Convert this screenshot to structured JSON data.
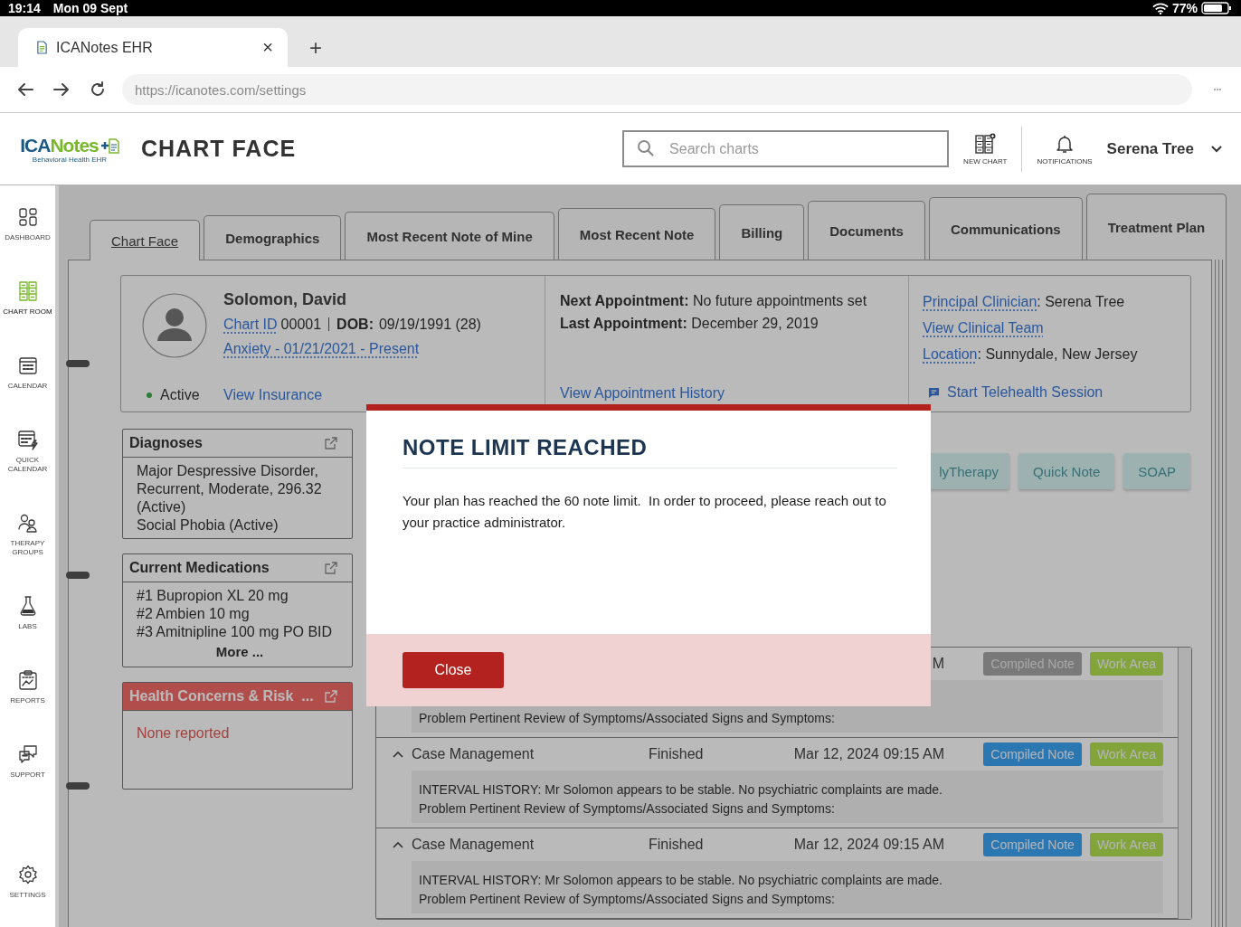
{
  "status_bar": {
    "time": "19:14",
    "date": "Mon 09 Sept",
    "battery": "77%"
  },
  "browser": {
    "tab": {
      "title": "ICANotes EHR",
      "close": "×"
    },
    "new_tab": "+",
    "url": "https://icanotes.com/settings"
  },
  "app_header": {
    "logo": {
      "first": "ICA",
      "second": "Notes",
      "tagline": "Behavioral Health EHR"
    },
    "title": "CHART FACE",
    "search": {
      "placeholder": "Search charts"
    },
    "actions": [
      {
        "label": "NEW CHART",
        "kind": "chart"
      },
      {
        "label": "NOTIFICATIONS",
        "kind": "bell"
      }
    ],
    "user": "Serena Tree"
  },
  "sidebar": {
    "items": [
      {
        "label": "DASHBOARD",
        "kind": "dashboard",
        "selected": false
      },
      {
        "label": "CHART ROOM",
        "kind": "chart",
        "selected": true
      },
      {
        "label": "CALENDAR",
        "kind": "calendar",
        "selected": false
      },
      {
        "label": "QUICK CALENDAR",
        "kind": "quickcal",
        "selected": false
      },
      {
        "label": "THERAPY GROUPS",
        "kind": "groups",
        "selected": false
      },
      {
        "label": "LABS",
        "kind": "labs",
        "selected": false
      },
      {
        "label": "REPORTS",
        "kind": "reports",
        "selected": false
      },
      {
        "label": "SUPPORT",
        "kind": "support",
        "selected": false
      },
      {
        "label": "SETTINGS",
        "kind": "settings",
        "selected": false
      }
    ]
  },
  "tabs": [
    {
      "label": "Chart Face",
      "selected": true
    },
    {
      "label": "Demographics",
      "selected": false
    },
    {
      "label": "Most Recent Note of Mine",
      "selected": false
    },
    {
      "label": "Most Recent Note",
      "selected": false
    },
    {
      "label": "Billing",
      "selected": false
    },
    {
      "label": "Documents",
      "selected": false
    },
    {
      "label": "Communications",
      "selected": false
    },
    {
      "label": "Treatment Plan",
      "selected": false
    }
  ],
  "patient": {
    "name": "Solomon, David",
    "chart_id_link": "Chart ID",
    "chart_id": "00001",
    "dob_label": "DOB:",
    "dob": "09/19/1991 (28)",
    "diagnosis_link": "Anxiety - 01/21/2021 - Present",
    "status": {
      "label": "Active",
      "color": "#2d7c36"
    },
    "insurance_link": "View Insurance",
    "next_appointment": "**Next Appointment:** No future appointments set",
    "last_appointment": "**Last Appointment:** December 29, 2019",
    "history_link": "View Appointment History",
    "clinician": {
      "link": "Principal Clinician",
      "text": ": Serena Tree"
    },
    "team_link": "View Clinical Team",
    "location": {
      "link": "Location",
      "text": ": Sunnydale, New Jersey"
    },
    "telehealth_link": "Start Telehealth Session"
  },
  "panels": [
    {
      "title": "Diagnoses",
      "kind": "normal",
      "lines": [
        "Major Despressive Disorder, Recurrent, Moderate, 296.32 (Active)",
        "Social Phobia (Active)"
      ]
    },
    {
      "title": "Current Medications",
      "kind": "normal",
      "lines": [
        "#1 Bupropion XL 20 mg",
        "#2 Ambien 10 mg",
        "#3 Amitnipline 100 mg PO BID"
      ],
      "more": "More ..."
    },
    {
      "title": "Health Concerns & Risk  ...",
      "kind": "alert",
      "lines": [
        "None reported"
      ]
    }
  ],
  "note_types": [
    "lyTherapy",
    "Quick Note",
    "SOAP"
  ],
  "notes": [
    {
      "date": "M",
      "expanded": true,
      "actions": [
        {
          "label": "Compiled Note",
          "kind": "compiled",
          "disabled": true
        },
        {
          "label": "Work Area",
          "kind": "work",
          "disabled": false
        }
      ],
      "lines": [
        "Problem Pertinent Review of Symptoms/Associated Signs and Symptoms:"
      ]
    },
    {
      "type": "Case Management",
      "status": "Finished",
      "date": "Mar 12, 2024 09:15 AM",
      "expanded": true,
      "actions": [
        {
          "label": "Compiled Note",
          "kind": "compiled",
          "disabled": false
        },
        {
          "label": "Work Area",
          "kind": "work",
          "disabled": false
        }
      ],
      "lines": [
        "INTERVAL HISTORY: Mr Solomon appears to be stable. No psychiatric complaints are made.",
        "Problem Pertinent Review of Symptoms/Associated Signs and Symptoms:"
      ]
    },
    {
      "type": "Case Management",
      "status": "Finished",
      "date": "Mar 12, 2024 09:15 AM",
      "expanded": true,
      "actions": [
        {
          "label": "Compiled Note",
          "kind": "compiled",
          "disabled": false
        },
        {
          "label": "Work Area",
          "kind": "work",
          "disabled": false
        }
      ],
      "lines": [
        "INTERVAL HISTORY: Mr Solomon appears to be stable. No psychiatric complaints are made.",
        "Problem Pertinent Review of Symptoms/Associated Signs and Symptoms:"
      ]
    }
  ],
  "modal": {
    "title": "NOTE LIMIT REACHED",
    "message": "Your plan has reached the 60 note limit.  In order to proceed, please reach out to your practice administrator.",
    "button": "Close"
  }
}
